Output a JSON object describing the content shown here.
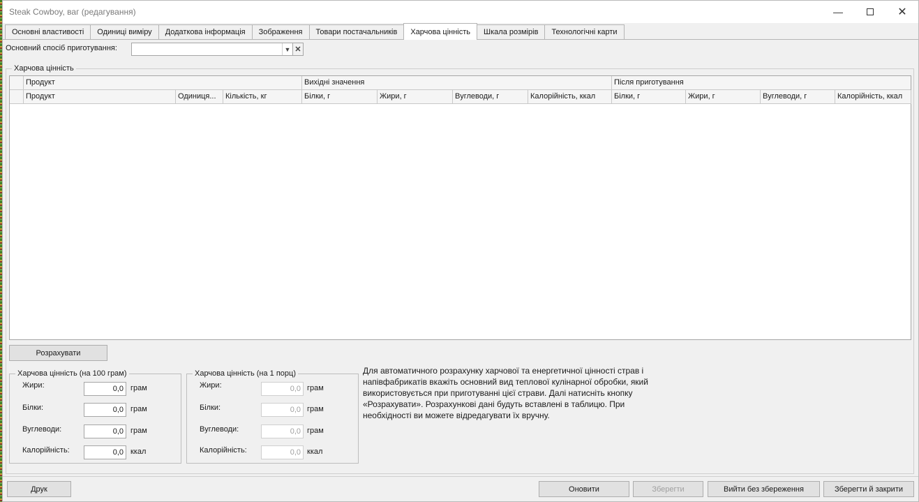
{
  "window": {
    "title": "Steak Cowboy, ваг (редагування)"
  },
  "tabs": [
    {
      "label": "Основні властивості"
    },
    {
      "label": "Одиниці виміру"
    },
    {
      "label": "Додаткова інформація"
    },
    {
      "label": "Зображення"
    },
    {
      "label": "Товари постачальників"
    },
    {
      "label": "Харчова цінність",
      "active": true
    },
    {
      "label": "Шкала розмірів"
    },
    {
      "label": "Технологічні карти"
    }
  ],
  "cooking": {
    "label": "Основний спосіб приготування:",
    "value": ""
  },
  "nutrition_group": {
    "title": "Харчова цінність",
    "grid": {
      "bands": [
        "Продукт",
        "Вихідні значення",
        "Після приготування"
      ],
      "columns": [
        "Продукт",
        "Одиниця...",
        "Кількість, кг",
        "Білки, г",
        "Жири, г",
        "Вуглеводи, г",
        "Калорійність, ккал",
        "Білки, г",
        "Жири, г",
        "Вуглеводи, г",
        "Калорійність, ккал"
      ],
      "rows": []
    }
  },
  "calc_button": "Розрахувати",
  "per100": {
    "title": "Харчова цінність (на 100 грам)",
    "rows": [
      {
        "label": "Жири:",
        "value": "0,0",
        "unit": "грам"
      },
      {
        "label": "Білки:",
        "value": "0,0",
        "unit": "грам"
      },
      {
        "label": "Вуглеводи:",
        "value": "0,0",
        "unit": "грам"
      },
      {
        "label": "Калорійність:",
        "value": "0,0",
        "unit": "ккал"
      }
    ]
  },
  "perPortion": {
    "title": "Харчова цінність (на 1 порц)",
    "rows": [
      {
        "label": "Жири:",
        "value": "0,0",
        "unit": "грам"
      },
      {
        "label": "Білки:",
        "value": "0,0",
        "unit": "грам"
      },
      {
        "label": "Вуглеводи:",
        "value": "0,0",
        "unit": "грам"
      },
      {
        "label": "Калорійність:",
        "value": "0,0",
        "unit": "ккал"
      }
    ]
  },
  "hint": "Для автоматичного розрахунку харчової та енергетичної цінності страв і напівфабрикатів вкажіть основний вид теплової кулінарної обробки, який використовується при приготуванні цієї страви. Далі натисніть кнопку «Розрахувати». Розрахункові дані будуть вставлені в таблицю. При необхідності ви можете відредагувати їх вручну.",
  "footer": {
    "print": "Друк",
    "refresh": "Оновити",
    "save": "Зберегти",
    "exit_no_save": "Вийти без збереження",
    "save_close": "Зберегти й закрити"
  }
}
